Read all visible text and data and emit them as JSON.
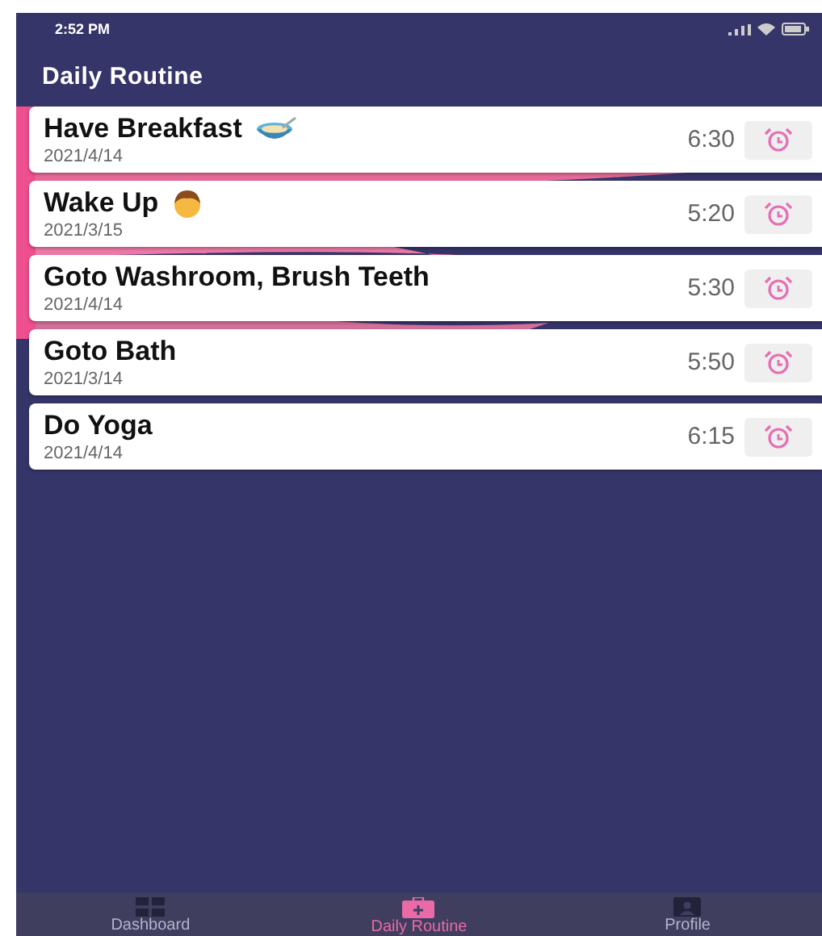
{
  "status_bar": {
    "time": "2:52 PM"
  },
  "header": {
    "title": "Daily Routine"
  },
  "routines": [
    {
      "name": "Have Breakfast",
      "kind": "bowl",
      "date": "2021/4/14",
      "time": "6:30"
    },
    {
      "name": "Wake Up",
      "kind": "person",
      "date": "2021/3/15",
      "time": "5:20"
    },
    {
      "name": "Goto Washroom, Brush Teeth",
      "kind": "plain",
      "date": "2021/4/14",
      "time": "5:30"
    },
    {
      "name": "Goto Bath",
      "kind": "plain",
      "date": "2021/3/14",
      "time": "5:50"
    },
    {
      "name": "Do Yoga",
      "kind": "plain",
      "date": "2021/4/14",
      "time": "6:15"
    }
  ],
  "nav": [
    {
      "label": "Dashboard",
      "kind": "grid",
      "selected": false
    },
    {
      "label": "Daily Routine",
      "kind": "kit",
      "selected": true
    },
    {
      "label": "Profile",
      "kind": "profile",
      "selected": false
    }
  ]
}
